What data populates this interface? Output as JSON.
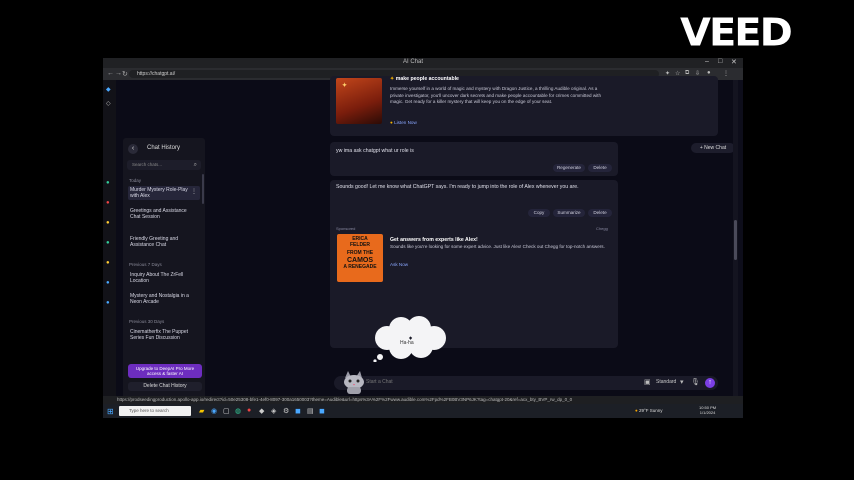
{
  "watermark": "VEED",
  "browser": {
    "tab_title": "AI Chat",
    "url": "https://chatgpt.ai/",
    "status_url": "https://prodseedingproduction.apollo-app.io/redirect?id=50e25308-bfe1-4ef0-8097-300a1650003?theme=Audible&url=https%3A%2F%2Fwww.audible.com%2Fpd%2FB0BV3NP6JK?tag=chatgpt-20&ref=acx_bty_BVP_rw_dp_0_0"
  },
  "sidebar": {
    "title": "Chat History",
    "search_placeholder": "Search chats...",
    "sections": [
      {
        "label": "Today",
        "items": [
          "Murder Mystery Role-Play with Alex",
          "Greetings and Assistance Chat Session",
          "Friendly Greeting and Assistance Chat"
        ]
      },
      {
        "label": "Previous 7 Days",
        "items": [
          "Inquiry About The ZrFell Location",
          "Mystery and Nostalgia in a Neon Arcade"
        ]
      },
      {
        "label": "Previous 30 Days",
        "items": [
          "Cinematherfix The Puppet Series Fun Discussion"
        ]
      }
    ],
    "upgrade_label": "Upgrade to DeepAI Pro More access & faster AI",
    "delete_label": "Delete Chat History"
  },
  "main": {
    "new_chat_label": "+ New Chat",
    "ad1": {
      "title": "make people accountable",
      "body": "Immerse yourself in a world of magic and mystery with Dragon Justice, a thrilling Audible original. As a private investigator, you'll uncover dark secrets and make people accountable for crimes committed with magic. Get ready for a killer mystery that will keep you on the edge of your seat.",
      "link": "Listen Now"
    },
    "user_message": "yw ima ask chatgpt what ur role is",
    "user_actions": [
      "Regenerate",
      "Delete"
    ],
    "assistant_message": "Sounds good! Let me know what ChatGPT says. I'm ready to jump into the role of Alex whenever you are.",
    "assistant_actions": [
      "Copy",
      "Summarize",
      "Delete"
    ],
    "ad2": {
      "sponsor_label": "Sponsored",
      "source_label": "Chegg",
      "cover_lines": [
        "ERICA",
        "FELDER",
        "FROM THE",
        "CAMOS",
        "A RENEGADE"
      ],
      "title": "Get answers from experts like Alex!",
      "body": "Sounds like you're looking for some expert advice. Just like Alex! Check out Chegg for top-notch answers.",
      "link": "Ask Now"
    },
    "bubble_text": "Ha-ha",
    "input_placeholder": "Start a Chat",
    "model_label": "Standard"
  },
  "taskbar": {
    "search_placeholder": "Type here to search",
    "weather": "29°F Sunny",
    "time": "10:50 PM",
    "date": "1/1/2024"
  },
  "colors": {
    "accent": "#7b3fe4",
    "page_bg": "#0b0b17",
    "card_bg": "#1a1a28"
  }
}
